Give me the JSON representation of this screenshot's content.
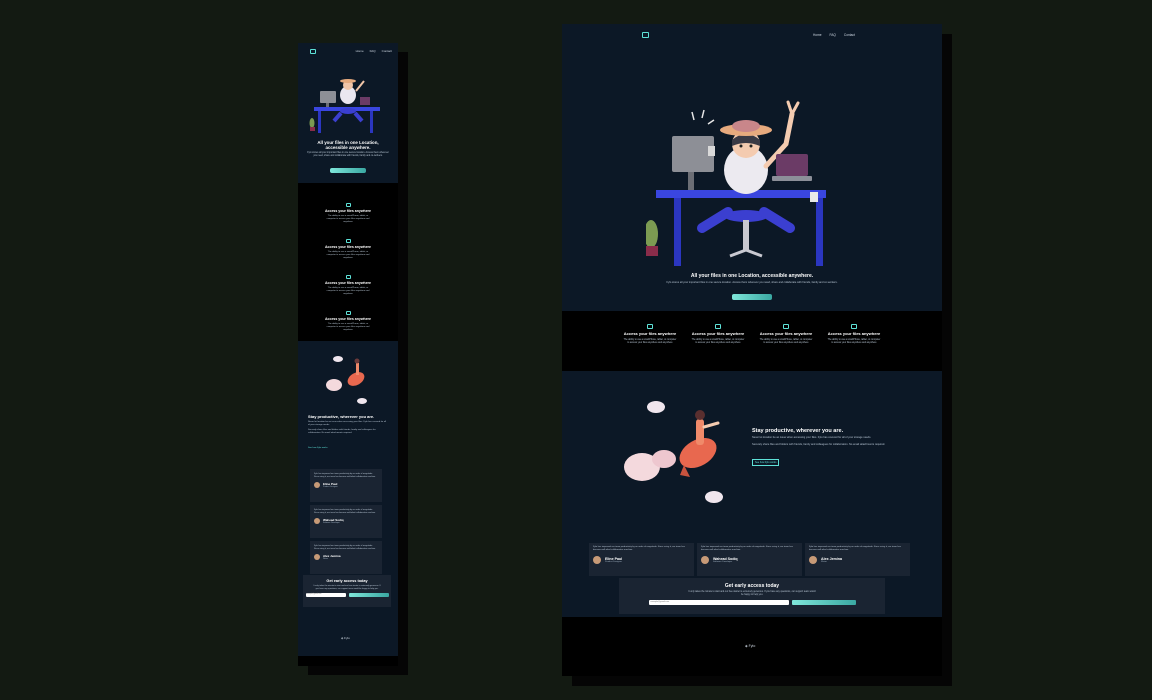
{
  "brand": {
    "logo_text": "Fylo"
  },
  "nav": {
    "items": [
      "Home",
      "FAQ",
      "Contact"
    ]
  },
  "hero": {
    "title_mobile": "All your files in one Location, accessible anywhere.",
    "title": "All your files in one Location, accessible anywhere.",
    "text": "Fylo stores all your important files in one secure location. Access them wherever you need, share and collaborate with friends, family and co-workers."
  },
  "features": [
    {
      "icon": "cloud-icon",
      "title": "Access your files anywhere",
      "text": "The ability to use a smartPhone, tablet, or computer to access your files anywhere and anywhere"
    },
    {
      "icon": "chart-icon",
      "title": "Access your files anywhere",
      "text": "The ability to use a smartPhone, tablet, or computer to access your files anywhere and anywhere"
    },
    {
      "icon": "bookmark-icon",
      "title": "Access your files anywhere",
      "text": "The ability to use a smartPhone, tablet, or computer to access your files anywhere and anywhere"
    },
    {
      "icon": "box-icon",
      "title": "Access your files anywhere",
      "text": "The ability to use a smartPhone, tablet, or computer to access your files anywhere and anywhere"
    }
  ],
  "productive": {
    "title": "Stay productive, wherever you are.",
    "text1": "Never let location be an issue when accessing your files. Fylo has covered for all of your storage needs.",
    "text2": "Securely share files and folders with friends, family and colleagues for collaboration. No email attachments required.",
    "link": "See how Fylo works"
  },
  "testimonials": [
    {
      "quote": "Fylo has improved our team productivity by an order of magnitude. Since using it, our team has become well-oiled collaborative machine.",
      "name": "Eline Paul",
      "role": "Product Designer"
    },
    {
      "quote": "Fylo has improved our team productivity by an order of magnitude. Since using it, our team has become well-oiled collaborative machine.",
      "name": "Wahead Sodiq",
      "role": "Software Developer"
    },
    {
      "quote": "Fylo has improved our team productivity by an order of magnitude. Since using it, our team has become well-oiled collaborative machine.",
      "name": "Alex Jemina",
      "role": "Writer"
    }
  ],
  "cta": {
    "title": "Get early access today",
    "text": "It only takes the minute to start and our free starter is extremely generous. If you have any questions, our support team would be happy to help you.",
    "placeholder": "example@gmail.com"
  },
  "colors": {
    "accent": "#5ee2d8",
    "panel": "#0c1826",
    "card": "#1a2432",
    "background": "#131a12"
  }
}
